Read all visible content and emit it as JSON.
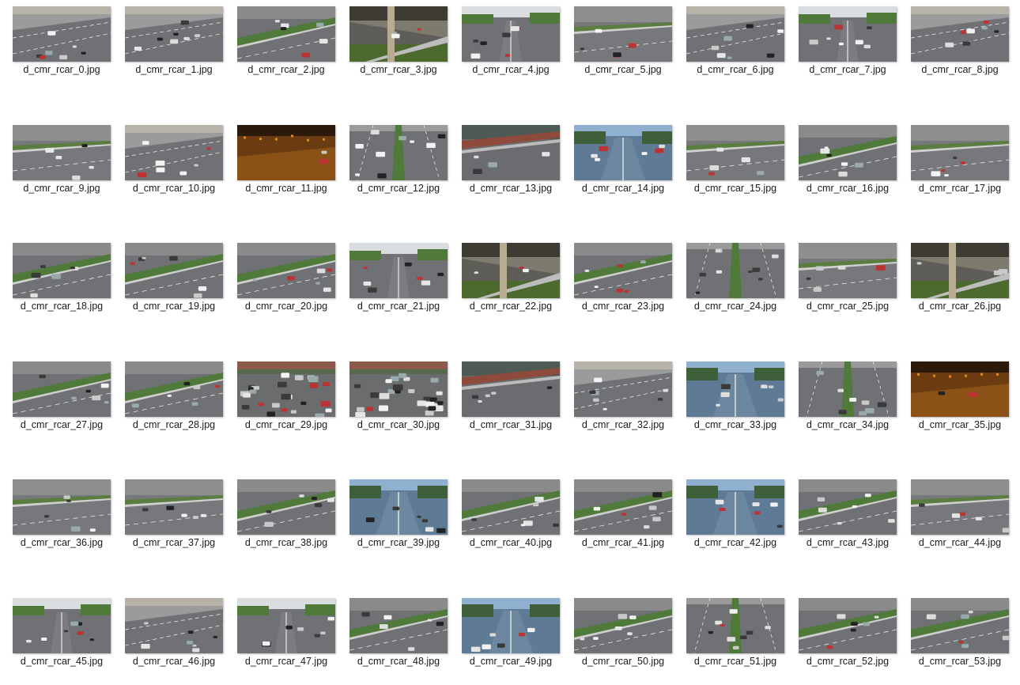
{
  "files": [
    {
      "name": "d_cmr_rcar_0.jpg",
      "scene": "street-day"
    },
    {
      "name": "d_cmr_rcar_1.jpg",
      "scene": "street-day"
    },
    {
      "name": "d_cmr_rcar_2.jpg",
      "scene": "highway-median"
    },
    {
      "name": "d_cmr_rcar_3.jpg",
      "scene": "dusk-pillar"
    },
    {
      "name": "d_cmr_rcar_4.jpg",
      "scene": "boulevard-trees"
    },
    {
      "name": "d_cmr_rcar_5.jpg",
      "scene": "highway-grey"
    },
    {
      "name": "d_cmr_rcar_6.jpg",
      "scene": "street-day"
    },
    {
      "name": "d_cmr_rcar_7.jpg",
      "scene": "boulevard-trees"
    },
    {
      "name": "d_cmr_rcar_8.jpg",
      "scene": "street-day"
    },
    {
      "name": "d_cmr_rcar_9.jpg",
      "scene": "highway-grey"
    },
    {
      "name": "d_cmr_rcar_10.jpg",
      "scene": "street-day"
    },
    {
      "name": "d_cmr_rcar_11.jpg",
      "scene": "night-orange"
    },
    {
      "name": "d_cmr_rcar_12.jpg",
      "scene": "highway-center"
    },
    {
      "name": "d_cmr_rcar_13.jpg",
      "scene": "highway-wet"
    },
    {
      "name": "d_cmr_rcar_14.jpg",
      "scene": "boulevard-blue"
    },
    {
      "name": "d_cmr_rcar_15.jpg",
      "scene": "highway-grey"
    },
    {
      "name": "d_cmr_rcar_16.jpg",
      "scene": "highway-median"
    },
    {
      "name": "d_cmr_rcar_17.jpg",
      "scene": "highway-grey"
    },
    {
      "name": "d_cmr_rcar_18.jpg",
      "scene": "highway-median"
    },
    {
      "name": "d_cmr_rcar_19.jpg",
      "scene": "highway-median"
    },
    {
      "name": "d_cmr_rcar_20.jpg",
      "scene": "highway-median"
    },
    {
      "name": "d_cmr_rcar_21.jpg",
      "scene": "boulevard-trees"
    },
    {
      "name": "d_cmr_rcar_22.jpg",
      "scene": "dusk-pillar"
    },
    {
      "name": "d_cmr_rcar_23.jpg",
      "scene": "highway-median"
    },
    {
      "name": "d_cmr_rcar_24.jpg",
      "scene": "highway-center"
    },
    {
      "name": "d_cmr_rcar_25.jpg",
      "scene": "highway-grey"
    },
    {
      "name": "d_cmr_rcar_26.jpg",
      "scene": "dusk-pillar"
    },
    {
      "name": "d_cmr_rcar_27.jpg",
      "scene": "highway-median"
    },
    {
      "name": "d_cmr_rcar_28.jpg",
      "scene": "highway-median"
    },
    {
      "name": "d_cmr_rcar_29.jpg",
      "scene": "jam-wet"
    },
    {
      "name": "d_cmr_rcar_30.jpg",
      "scene": "jam-wet"
    },
    {
      "name": "d_cmr_rcar_31.jpg",
      "scene": "highway-wet"
    },
    {
      "name": "d_cmr_rcar_32.jpg",
      "scene": "street-day"
    },
    {
      "name": "d_cmr_rcar_33.jpg",
      "scene": "boulevard-blue"
    },
    {
      "name": "d_cmr_rcar_34.jpg",
      "scene": "highway-center"
    },
    {
      "name": "d_cmr_rcar_35.jpg",
      "scene": "night-orange"
    },
    {
      "name": "d_cmr_rcar_36.jpg",
      "scene": "highway-grey"
    },
    {
      "name": "d_cmr_rcar_37.jpg",
      "scene": "highway-grey"
    },
    {
      "name": "d_cmr_rcar_38.jpg",
      "scene": "highway-median"
    },
    {
      "name": "d_cmr_rcar_39.jpg",
      "scene": "boulevard-blue"
    },
    {
      "name": "d_cmr_rcar_40.jpg",
      "scene": "highway-median"
    },
    {
      "name": "d_cmr_rcar_41.jpg",
      "scene": "highway-median"
    },
    {
      "name": "d_cmr_rcar_42.jpg",
      "scene": "boulevard-blue"
    },
    {
      "name": "d_cmr_rcar_43.jpg",
      "scene": "highway-median"
    },
    {
      "name": "d_cmr_rcar_44.jpg",
      "scene": "highway-grey"
    },
    {
      "name": "d_cmr_rcar_45.jpg",
      "scene": "boulevard-trees"
    },
    {
      "name": "d_cmr_rcar_46.jpg",
      "scene": "street-day"
    },
    {
      "name": "d_cmr_rcar_47.jpg",
      "scene": "boulevard-trees"
    },
    {
      "name": "d_cmr_rcar_48.jpg",
      "scene": "highway-median"
    },
    {
      "name": "d_cmr_rcar_49.jpg",
      "scene": "boulevard-blue"
    },
    {
      "name": "d_cmr_rcar_50.jpg",
      "scene": "highway-median"
    },
    {
      "name": "d_cmr_rcar_51.jpg",
      "scene": "highway-center"
    },
    {
      "name": "d_cmr_rcar_52.jpg",
      "scene": "highway-median"
    },
    {
      "name": "d_cmr_rcar_53.jpg",
      "scene": "highway-median"
    }
  ],
  "palette": {
    "road": "#6f7174",
    "road_dark": "#4e5053",
    "wall": "#8a8a8a",
    "sky": "#d9dde0",
    "green": "#4f7a3a",
    "night": "#6b3c12",
    "night_light": "#d98a2a",
    "blue_sky": "#8fb0cf",
    "lane": "#e8e8e8",
    "caption_text": "#1a1a1a"
  }
}
